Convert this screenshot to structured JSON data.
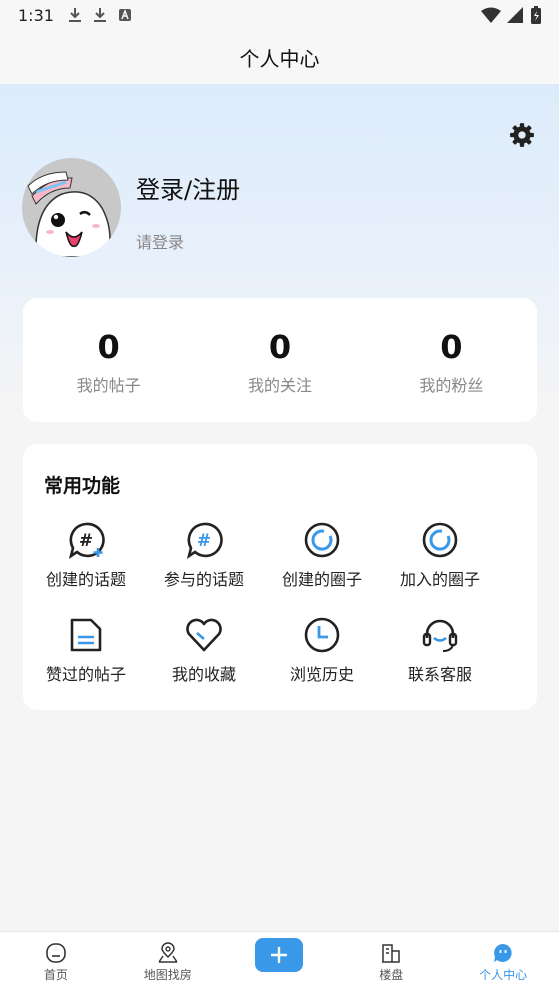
{
  "status_bar": {
    "time": "1:31"
  },
  "header": {
    "title": "个人中心"
  },
  "profile": {
    "title": "登录/注册",
    "subtitle": "请登录"
  },
  "stats": [
    {
      "value": "0",
      "label": "我的帖子"
    },
    {
      "value": "0",
      "label": "我的关注"
    },
    {
      "value": "0",
      "label": "我的粉丝"
    }
  ],
  "functions": {
    "title": "常用功能",
    "items": [
      {
        "label": "创建的话题",
        "icon": "topic-add-icon"
      },
      {
        "label": "参与的话题",
        "icon": "topic-icon"
      },
      {
        "label": "创建的圈子",
        "icon": "circle-icon"
      },
      {
        "label": "加入的圈子",
        "icon": "circle-icon"
      },
      {
        "label": "赞过的帖子",
        "icon": "document-icon"
      },
      {
        "label": "我的收藏",
        "icon": "heart-icon"
      },
      {
        "label": "浏览历史",
        "icon": "clock-icon"
      },
      {
        "label": "联系客服",
        "icon": "headset-icon"
      }
    ]
  },
  "tabs": [
    {
      "label": "首页",
      "icon": "home-icon"
    },
    {
      "label": "地图找房",
      "icon": "map-pin-icon"
    },
    {
      "label": "楼盘",
      "icon": "building-icon"
    },
    {
      "label": "个人中心",
      "icon": "profile-icon",
      "active": true
    }
  ],
  "colors": {
    "accent": "#3a98e8",
    "hero_bg": "#dcebfb"
  }
}
